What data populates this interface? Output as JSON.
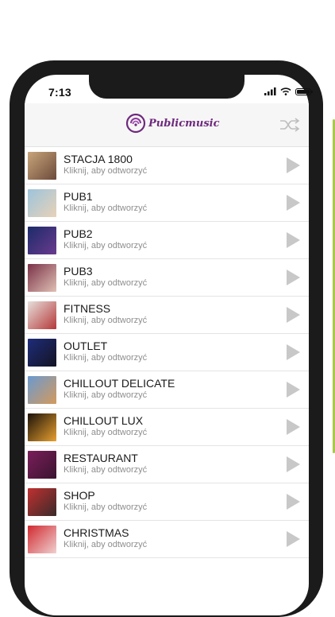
{
  "status": {
    "time": "7:13"
  },
  "header": {
    "logo_text": "Publicmusic"
  },
  "list": {
    "items": [
      {
        "title": "STACJA 1800",
        "subtitle": "Kliknij, aby odtworzyć",
        "thumb_colors": [
          "#c9a57a",
          "#6b4a3a"
        ]
      },
      {
        "title": "PUB1",
        "subtitle": "Kliknij, aby odtworzyć",
        "thumb_colors": [
          "#9cc4dc",
          "#e8d2b8"
        ]
      },
      {
        "title": "PUB2",
        "subtitle": "Kliknij, aby odtworzyć",
        "thumb_colors": [
          "#1c2b6a",
          "#6a3a8e"
        ]
      },
      {
        "title": "PUB3",
        "subtitle": "Kliknij, aby odtworzyć",
        "thumb_colors": [
          "#7a3248",
          "#e0c0b4"
        ]
      },
      {
        "title": "FITNESS",
        "subtitle": "Kliknij, aby odtworzyć",
        "thumb_colors": [
          "#e6e0dc",
          "#b53838"
        ]
      },
      {
        "title": "OUTLET",
        "subtitle": "Kliknij, aby odtworzyć",
        "thumb_colors": [
          "#1e2c7a",
          "#141422"
        ]
      },
      {
        "title": "CHILLOUT DELICATE",
        "subtitle": "Kliknij, aby odtworzyć",
        "thumb_colors": [
          "#6a9ad0",
          "#d49a5c"
        ]
      },
      {
        "title": "CHILLOUT LUX",
        "subtitle": "Kliknij, aby odtworzyć",
        "thumb_colors": [
          "#1a1208",
          "#e8a030"
        ]
      },
      {
        "title": "RESTAURANT",
        "subtitle": "Kliknij, aby odtworzyć",
        "thumb_colors": [
          "#7a1e5a",
          "#3a1430"
        ]
      },
      {
        "title": "SHOP",
        "subtitle": "Kliknij, aby odtworzyć",
        "thumb_colors": [
          "#c03030",
          "#3a2a2a"
        ]
      },
      {
        "title": "CHRISTMAS",
        "subtitle": "Kliknij, aby odtworzyć",
        "thumb_colors": [
          "#d02a30",
          "#f0d0d0"
        ]
      }
    ]
  },
  "colors": {
    "accent_green": "#a8c84a",
    "logo_purple": "#6d2a7e",
    "play_gray": "#c8c8c8"
  },
  "icons": {
    "header_right": "shuffle-icon",
    "row_action": "play-icon"
  }
}
